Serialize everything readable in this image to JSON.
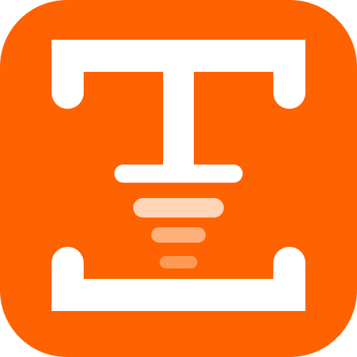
{
  "icon": {
    "name": "text-scan-app-icon",
    "glyph": "text-cursor-scan-icon",
    "colors": {
      "background": "#FF6200",
      "foreground": "#FFFFFF",
      "scan_line_1": "#FFD5B8",
      "scan_line_2": "#FFB07A",
      "scan_line_3": "#FF9A55"
    }
  }
}
